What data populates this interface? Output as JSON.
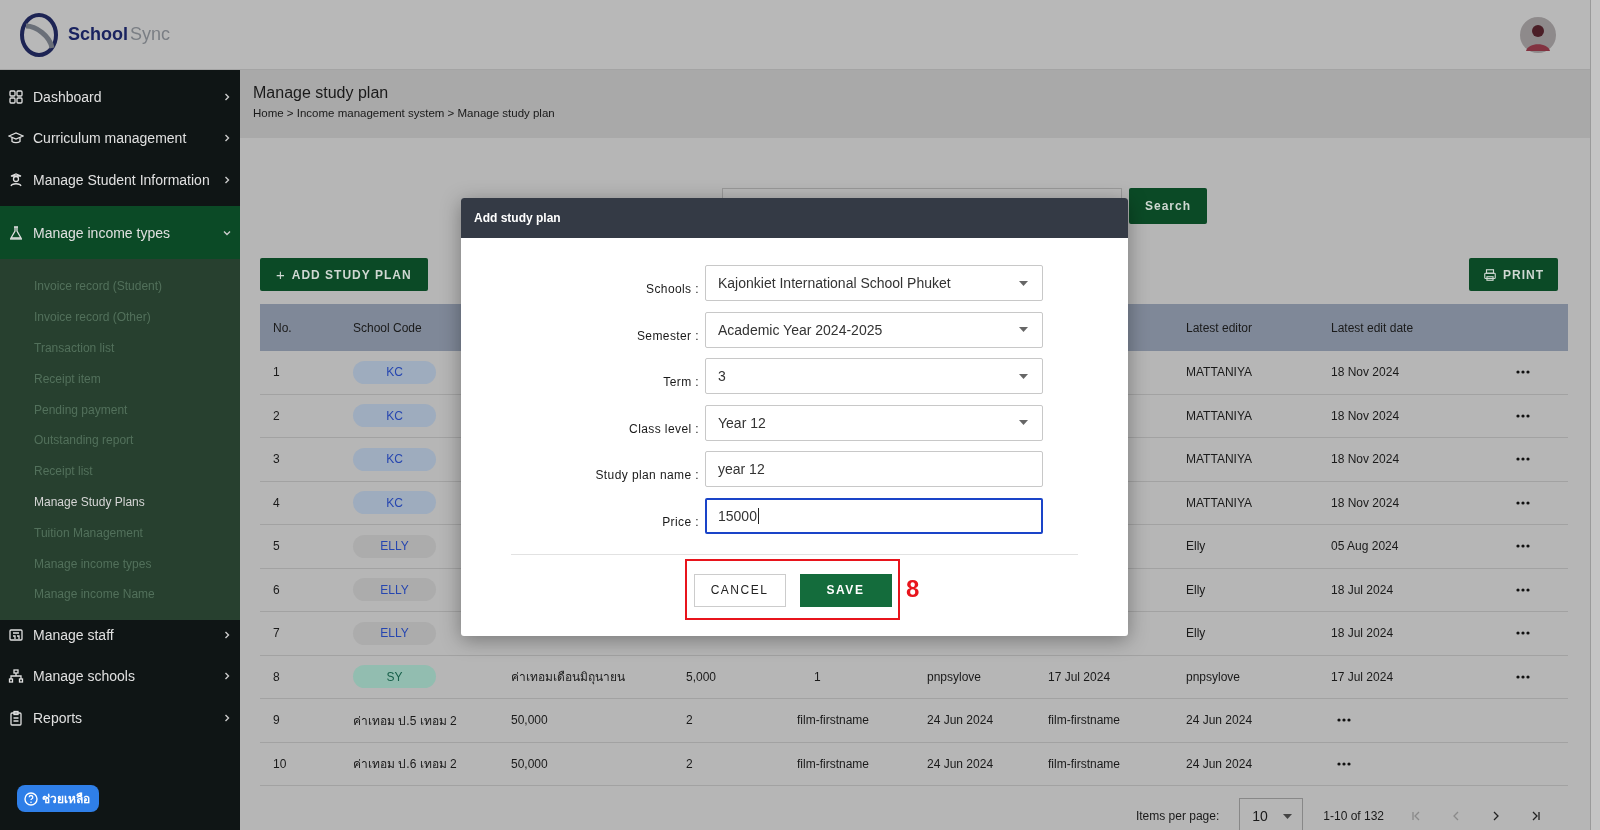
{
  "app": {
    "logo_part_1": "School",
    "logo_part_2": "Sync"
  },
  "sidebar": {
    "items": [
      {
        "label": "Dashboard",
        "expanded": false
      },
      {
        "label": "Curriculum management",
        "expanded": false
      },
      {
        "label": "Manage Student Information",
        "expanded": false
      },
      {
        "label": "Manage income types",
        "expanded": true,
        "children": [
          {
            "label": "Invoice record (Student)",
            "selected": false
          },
          {
            "label": "Invoice record (Other)",
            "selected": false
          },
          {
            "label": "Transaction list",
            "selected": false
          },
          {
            "label": "Receipt item",
            "selected": false
          },
          {
            "label": "Pending payment",
            "selected": false
          },
          {
            "label": "Outstanding report",
            "selected": false
          },
          {
            "label": "Receipt list",
            "selected": false
          },
          {
            "label": "Manage Study Plans",
            "selected": true
          },
          {
            "label": "Tuition Management",
            "selected": false
          },
          {
            "label": "Manage income types",
            "selected": false
          },
          {
            "label": "Manage income Name",
            "selected": false
          }
        ]
      },
      {
        "label": "Manage staff",
        "expanded": false
      },
      {
        "label": "Manage schools",
        "expanded": false
      },
      {
        "label": "Reports",
        "expanded": false
      }
    ]
  },
  "help_button": {
    "label": "ช่วยเหลือ"
  },
  "page_header": {
    "title": "Manage study plan",
    "breadcrumb": "Home > Income management system > Manage study plan"
  },
  "toolbar": {
    "search_button": "Search",
    "add_icon": "+",
    "add_button": "ADD STUDY PLAN",
    "print_button": "PRINT"
  },
  "table": {
    "columns": [
      "No.",
      "School Code",
      "",
      "",
      "",
      "",
      "",
      "Latest editor",
      "Latest edit date"
    ],
    "rows": [
      {
        "no": "1",
        "badge": {
          "text": "KC",
          "color": "#9eacbe"
        },
        "cells": [
          "",
          "",
          "",
          "",
          "",
          "MATTANIYA",
          "18 Nov 2024"
        ]
      },
      {
        "no": "2",
        "badge": {
          "text": "KC",
          "color": "#9eacbe"
        },
        "cells": [
          "",
          "",
          "",
          "",
          "",
          "MATTANIYA",
          "18 Nov 2024"
        ]
      },
      {
        "no": "3",
        "badge": {
          "text": "KC",
          "color": "#9eacbe"
        },
        "cells": [
          "",
          "",
          "",
          "",
          "",
          "MATTANIYA",
          "18 Nov 2024"
        ]
      },
      {
        "no": "4",
        "badge": {
          "text": "KC",
          "color": "#9eacbe"
        },
        "cells": [
          "",
          "",
          "",
          "",
          "",
          "MATTANIYA",
          "18 Nov 2024"
        ]
      },
      {
        "no": "5",
        "badge": {
          "text": "ELLY",
          "color": "#acacac"
        },
        "cells": [
          "",
          "",
          "",
          "",
          "",
          "Elly",
          "05 Aug 2024"
        ]
      },
      {
        "no": "6",
        "badge": {
          "text": "ELLY",
          "color": "#acacac"
        },
        "cells": [
          "",
          "",
          "",
          "",
          "",
          "Elly",
          "18 Jul 2024"
        ]
      },
      {
        "no": "7",
        "badge": {
          "text": "ELLY",
          "color": "#acacac"
        },
        "cells": [
          "",
          "",
          "",
          "",
          "",
          "Elly",
          "18 Jul 2024"
        ]
      },
      {
        "no": "8",
        "badge": {
          "text": "SY",
          "color": "#92bdb0"
        },
        "cells": [
          "ค่าเทอมเดือนมิถุนายน",
          "5,000",
          "1",
          "pnpsylove",
          "17 Jul 2024",
          "pnpsylove",
          "17 Jul 2024"
        ]
      },
      {
        "no": "9",
        "school_code": "ค่าเทอม ป.5 เทอม 2",
        "cells": [
          "50,000",
          "2",
          "film-firstname",
          "24 Jun 2024",
          "film-firstname",
          "24 Jun 2024"
        ]
      },
      {
        "no": "10",
        "school_code": "ค่าเทอม ป.6 เทอม 2",
        "cells": [
          "50,000",
          "2",
          "film-firstname",
          "24 Jun 2024",
          "film-firstname",
          "24 Jun 2024"
        ]
      }
    ]
  },
  "pagination": {
    "label": "Items per page:",
    "page_size": "10",
    "range": "1-10 of 132",
    "buttons": [
      {
        "disabled": true
      },
      {
        "disabled": true
      },
      {
        "disabled": false
      },
      {
        "disabled": false
      }
    ]
  },
  "modal": {
    "title": "Add study plan",
    "fields": [
      {
        "label": "Schools :",
        "kind": "select",
        "value": "Kajonkiet International School Phuket",
        "focused": false
      },
      {
        "label": "Semester :",
        "kind": "select",
        "value": "Academic Year 2024-2025",
        "focused": false
      },
      {
        "label": "Term :",
        "kind": "select",
        "value": "3",
        "focused": false
      },
      {
        "label": "Class level :",
        "kind": "select",
        "value": "Year 12",
        "focused": false
      },
      {
        "label": "Study plan name :",
        "kind": "input",
        "value": "year 12",
        "focused": false
      },
      {
        "label": "Price :",
        "kind": "input",
        "value": "15000",
        "focused": true
      }
    ],
    "cancel_button": "CANCEL",
    "save_button": "SAVE"
  },
  "annotation": {
    "label": "8"
  }
}
